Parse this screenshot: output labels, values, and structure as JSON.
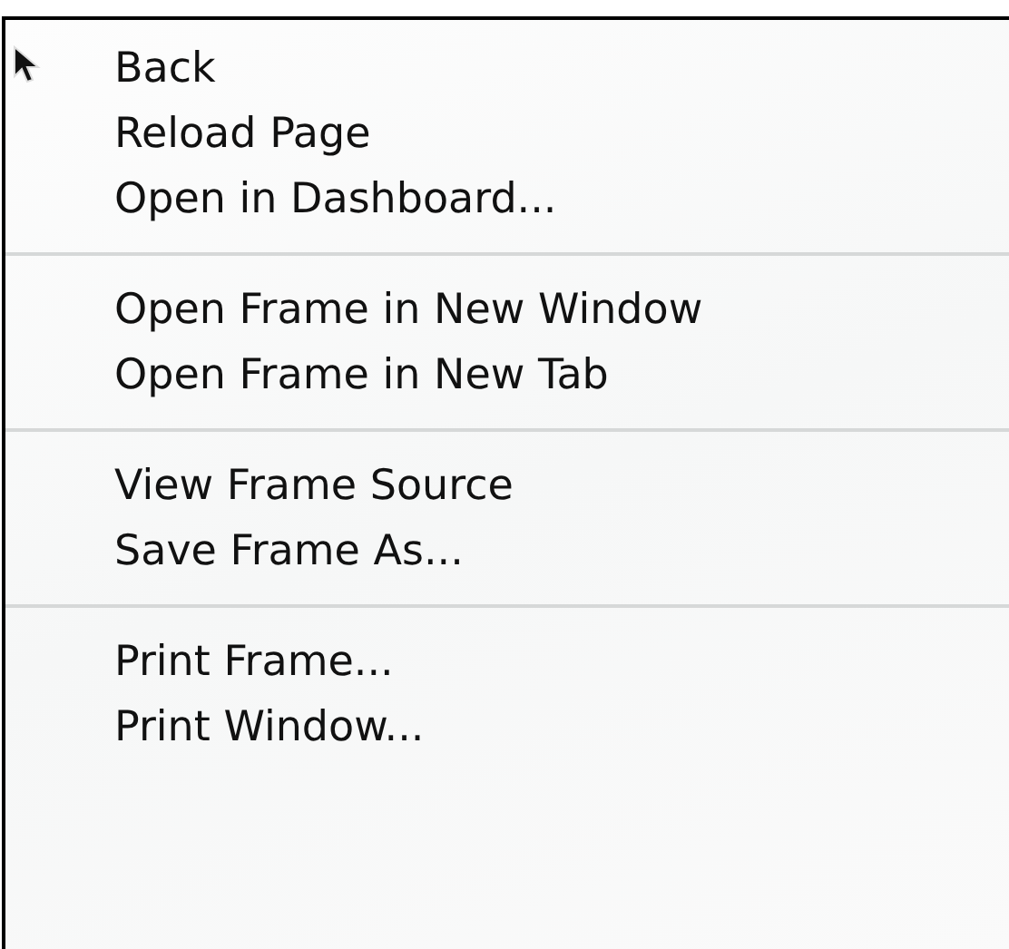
{
  "menu": {
    "groups": [
      {
        "items": [
          "Back",
          "Reload Page",
          "Open in Dashboard..."
        ]
      },
      {
        "items": [
          "Open Frame in New Window",
          "Open Frame in New Tab"
        ]
      },
      {
        "items": [
          "View Frame Source",
          "Save Frame As..."
        ]
      },
      {
        "items": [
          "Print Frame...",
          "Print Window..."
        ]
      }
    ]
  }
}
